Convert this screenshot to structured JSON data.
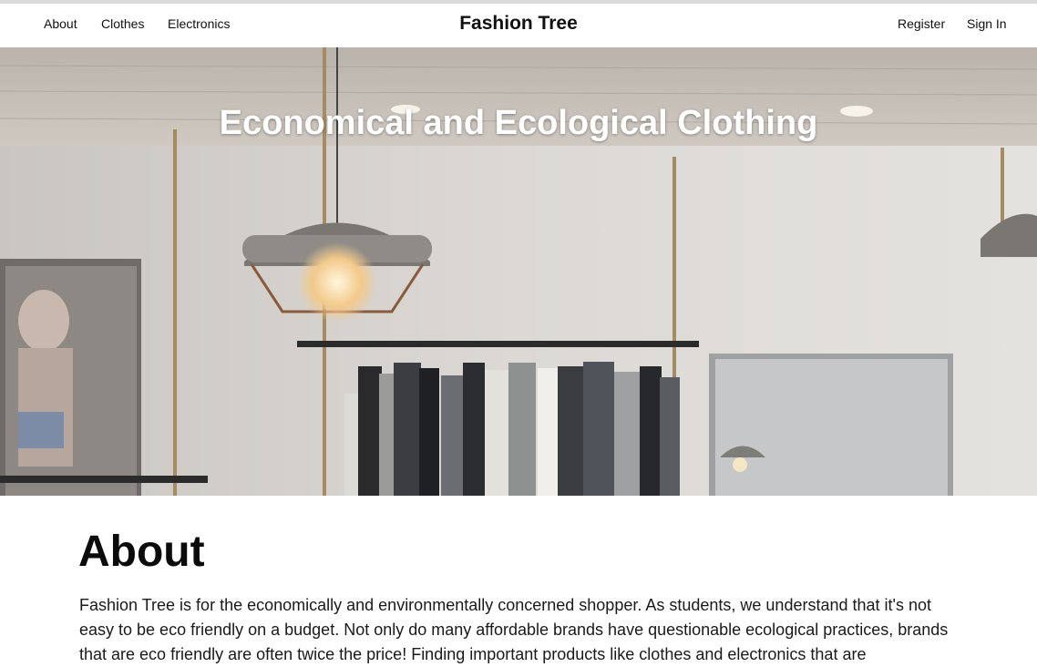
{
  "nav": {
    "left_links": [
      "About",
      "Clothes",
      "Electronics"
    ],
    "brand": "Fashion Tree",
    "right_links": [
      "Register",
      "Sign In"
    ]
  },
  "hero": {
    "title": "Economical and Ecological Clothing",
    "image": "clothing-store-interior-photo"
  },
  "about": {
    "heading": "About",
    "body": "Fashion Tree is for the economically and environmentally concerned shopper. As students, we understand that it's not easy to be eco friendly on a budget. Not only do many affordable brands have questionable ecological practices, brands that are eco friendly are often twice the price! Finding important products like clothes and electronics that are"
  },
  "colors": {
    "text": "#111111",
    "background": "#ffffff",
    "hero_title": "#ffffff"
  }
}
